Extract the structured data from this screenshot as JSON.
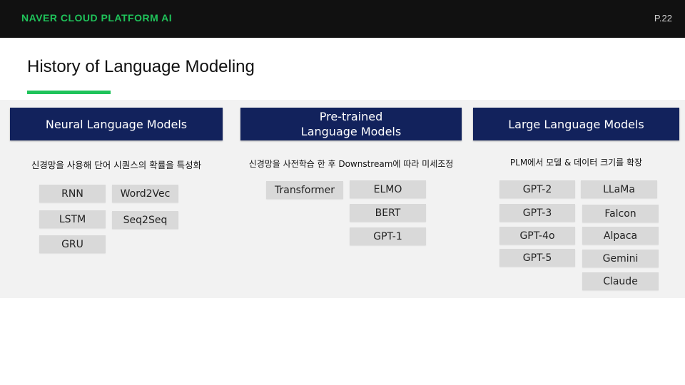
{
  "header": {
    "brand": "NAVER CLOUD PLATFORM AI",
    "page": "P.22"
  },
  "slide": {
    "title": "History of Language Modeling"
  },
  "columns": [
    {
      "heading": "Neural Language Models",
      "description": "신경망을 사용해 단어 시퀀스의 확률을 특성화",
      "models": [
        "RNN",
        "LSTM",
        "GRU",
        "Word2Vec",
        "Seq2Seq"
      ]
    },
    {
      "heading_line1": "Pre-trained",
      "heading_line2": "Language Models",
      "description": "신경망을 사전학습 한 후 Downstream에 따라 미세조정",
      "models": [
        "Transformer",
        "ELMO",
        "BERT",
        "GPT-1"
      ]
    },
    {
      "heading": "Large Language Models",
      "description": "PLM에서 모델 & 데이터 크기를 확장",
      "models": [
        "GPT-2",
        "GPT-3",
        "GPT-4o",
        "GPT-5",
        "LLaMa",
        "Falcon",
        "Alpaca",
        "Gemini",
        "Claude"
      ]
    }
  ],
  "colors": {
    "accent": "#1fc35a",
    "header_bg": "#12225c",
    "chip_bg": "#d9d9d9"
  }
}
